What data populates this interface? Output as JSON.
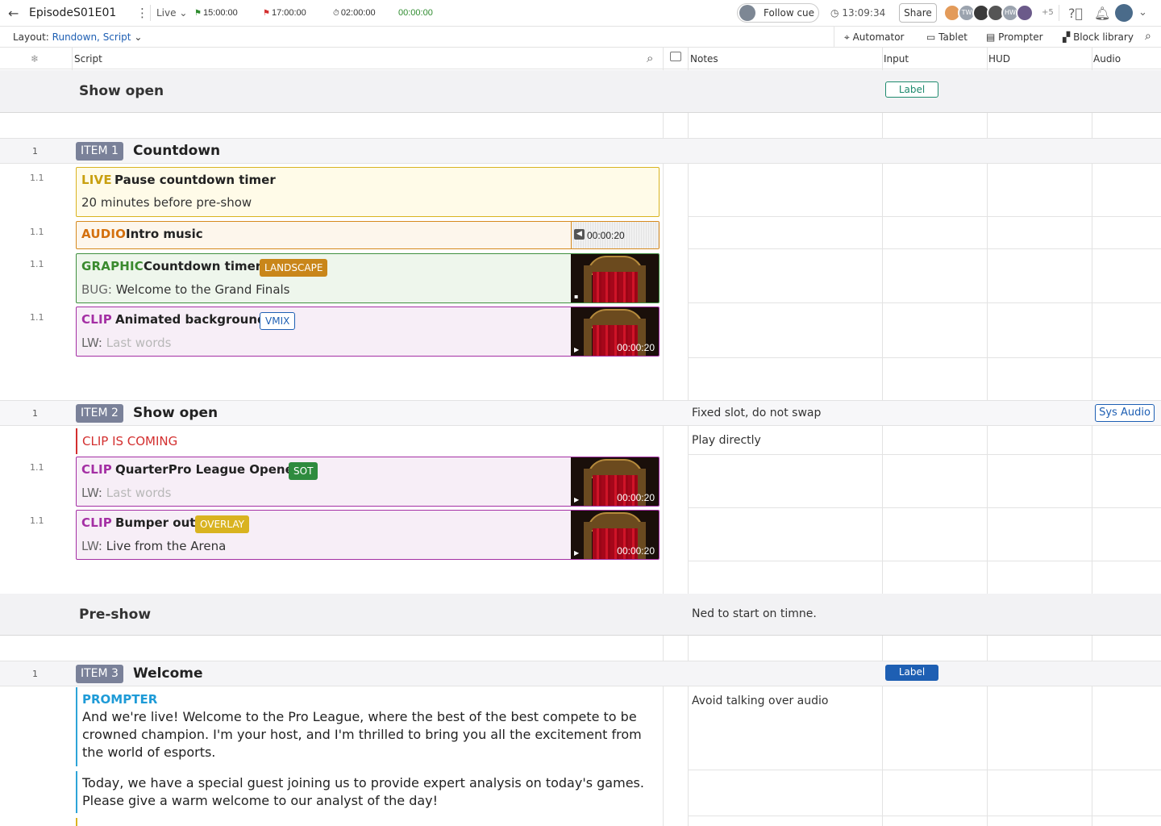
{
  "header": {
    "back_icon": "arrow-left-icon",
    "title": "EpisodeS01E01",
    "mode": "Live",
    "start_time": "15:00:00",
    "end_time": "17:00:00",
    "duration": "02:00:00",
    "elapsed": "00:00:00",
    "follow_cue": "Follow cue",
    "clock": "13:09:34",
    "share": "Share",
    "users_more": "+5",
    "accent_color": "#1e5fb3",
    "green_time_color": "#2e8b2e"
  },
  "toolbar": {
    "layout_label": "Layout:",
    "layout_value": "Rundown, Script",
    "automator": "Automator",
    "tablet": "Tablet",
    "prompter": "Prompter",
    "block_library": "Block library"
  },
  "columns": {
    "script": "Script",
    "notes": "Notes",
    "input": "Input",
    "hud": "HUD",
    "audio": "Audio"
  },
  "segments": [
    {
      "title": "Show open",
      "input_chip": "Label"
    },
    {
      "title": "Pre-show",
      "note": "Ned to start on timne."
    }
  ],
  "items": [
    {
      "num": "1",
      "tag": "ITEM 1",
      "title": "Countdown"
    },
    {
      "num": "1",
      "tag": "ITEM 2",
      "title": "Show open",
      "note": "Fixed slot, do not swap",
      "audio_chip": "Sys Audio"
    },
    {
      "num": "1",
      "tag": "ITEM 3",
      "title": "Welcome",
      "input_chip": "Label"
    }
  ],
  "cards": [
    {
      "row": "1.1",
      "type": "LIVE",
      "title": "Pause countdown timer",
      "line": "20 minutes before pre-show"
    },
    {
      "row": "1.1",
      "type": "AUDIO",
      "title": "Intro music",
      "duration": "00:00:20"
    },
    {
      "row": "1.1",
      "type": "GRAPHIC",
      "title": "Countdown timer",
      "badge": "LANDSCAPE",
      "line_label": "BUG:",
      "line": "Welcome to the Grand Finals"
    },
    {
      "row": "1.1",
      "type": "CLIP",
      "title": "Animated background",
      "badge": "VMIX",
      "line_label": "LW:",
      "line_placeholder": "Last words",
      "duration": "00:00:20"
    },
    {
      "row": "1.1",
      "type": "CLIP",
      "title": "QuarterPro League Opener",
      "badge": "SOT",
      "line_label": "LW:",
      "line_placeholder": "Last words",
      "duration": "00:00:20"
    },
    {
      "row": "1.1",
      "type": "CLIP",
      "title": "Bumper out",
      "badge": "OVERLAY",
      "line_label": "LW:",
      "line": "Live from the Arena",
      "duration": "00:00:20"
    }
  ],
  "coming": {
    "text": "CLIP IS COMING",
    "note": "Play directly"
  },
  "prompter": {
    "type": "PROMPTER",
    "para1": "And we're live! Welcome to the Pro League, where the best of the best compete to be crowned champion. I'm your host, and I'm thrilled to bring you all the excitement from the world of esports.",
    "para2": "Today, we have a special guest joining us to provide expert analysis on today's games. Please give a warm welcome to our analyst of the day!",
    "note": "Avoid  talking over audio"
  }
}
